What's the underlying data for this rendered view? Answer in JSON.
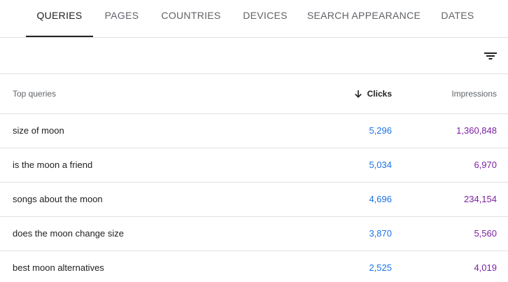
{
  "tabs": [
    {
      "label": "QUERIES",
      "active": true
    },
    {
      "label": "PAGES",
      "active": false
    },
    {
      "label": "COUNTRIES",
      "active": false
    },
    {
      "label": "DEVICES",
      "active": false
    },
    {
      "label": "SEARCH APPEARANCE",
      "active": false
    },
    {
      "label": "DATES",
      "active": false
    }
  ],
  "toolbar": {
    "filter_icon": "filter-list-icon"
  },
  "table": {
    "headers": {
      "query": "Top queries",
      "clicks": "Clicks",
      "impressions": "Impressions",
      "sort_icon": "arrow-down-icon"
    },
    "rows": [
      {
        "query": "size of moon",
        "clicks": "5,296",
        "impressions": "1,360,848"
      },
      {
        "query": "is the moon a friend",
        "clicks": "5,034",
        "impressions": "6,970"
      },
      {
        "query": "songs about the moon",
        "clicks": "4,696",
        "impressions": "234,154"
      },
      {
        "query": "does the moon change size",
        "clicks": "3,870",
        "impressions": "5,560"
      },
      {
        "query": "best moon alternatives",
        "clicks": "2,525",
        "impressions": "4,019"
      }
    ]
  },
  "colors": {
    "clicks": "#1a73e8",
    "impressions": "#7b1fa2",
    "active_tab_underline": "#202124"
  }
}
